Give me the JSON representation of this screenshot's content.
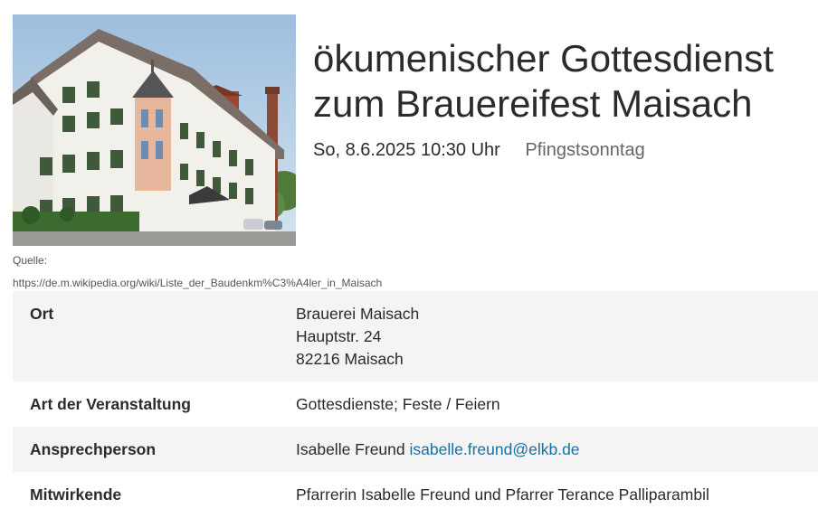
{
  "event": {
    "title_line1": "ökumenischer Gottesdienst",
    "title_line2": "zum Brauereifest Maisach",
    "datetime": "So, 8.6.2025 10:30 Uhr",
    "occasion": "Pfingstsonntag"
  },
  "image": {
    "caption_label": "Quelle:",
    "caption_url": "https://de.m.wikipedia.org/wiki/Liste_der_Baudenkm%C3%A4ler_in_Maisach"
  },
  "details": {
    "ort": {
      "label": "Ort",
      "line1": "Brauerei Maisach",
      "line2": "Hauptstr. 24",
      "line3": "82216 Maisach"
    },
    "art": {
      "label": "Art der Veranstaltung",
      "value": "Gottesdienste; Feste / Feiern"
    },
    "kontakt": {
      "label": "Ansprechperson",
      "name": "Isabelle Freund",
      "email": "isabelle.freund@elkb.de"
    },
    "mitwirkende": {
      "label": "Mitwirkende",
      "value": "Pfarrerin Isabelle Freund und Pfarrer Terance Palliparambil"
    }
  },
  "colors": {
    "link": "#1a6f9e",
    "row_shade": "#f4f4f4",
    "text": "#2b2b2b"
  }
}
